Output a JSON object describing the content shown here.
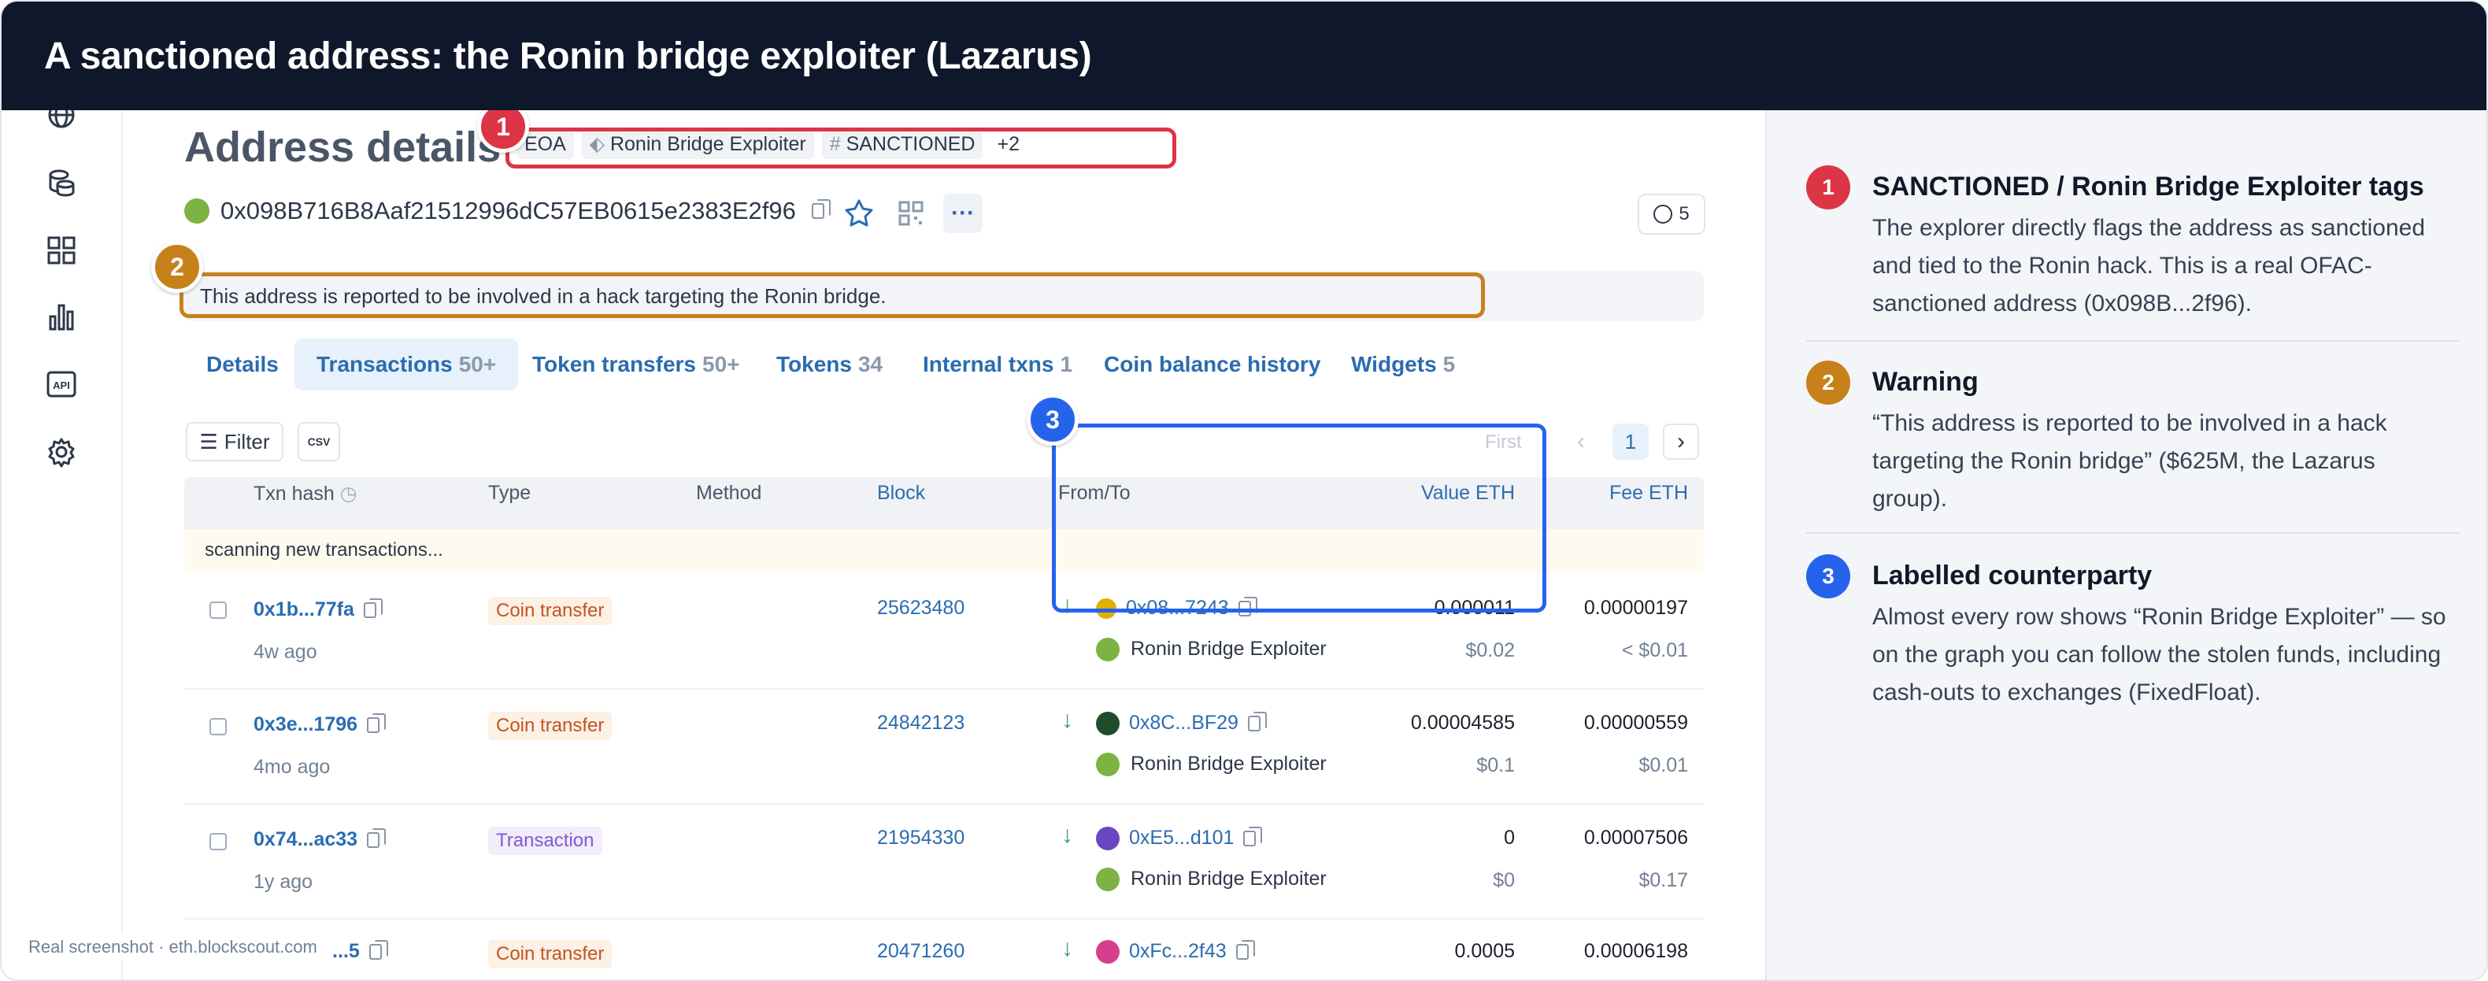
{
  "title": "A sanctioned address: the Ronin bridge exploiter (Lazarus)",
  "colors": {
    "red": "#dc3545",
    "amber": "#c7811a",
    "blue": "#2563eb",
    "green": "#7cb342",
    "link": "#2b6cb0"
  },
  "sidebar": {
    "icons": [
      "globe-icon",
      "database-icon",
      "grid-icon",
      "chart-icon",
      "api-icon",
      "gear-icon"
    ],
    "api_label": "API"
  },
  "page": {
    "heading": "Address details",
    "tags": [
      "EOA",
      "Ronin Bridge Exploiter",
      "SANCTIONED",
      "+2"
    ],
    "address": "0x098B716B8Aaf21512996dC57EB0615e2383E2f96",
    "counter": "5",
    "warning": "This address is reported to be involved in a hack targeting the Ronin bridge."
  },
  "tabs": [
    {
      "label": "Details",
      "count": ""
    },
    {
      "label": "Transactions",
      "count": "50+"
    },
    {
      "label": "Token transfers",
      "count": "50+"
    },
    {
      "label": "Tokens",
      "count": "34"
    },
    {
      "label": "Internal txns",
      "count": "1"
    },
    {
      "label": "Coin balance history",
      "count": ""
    },
    {
      "label": "Widgets",
      "count": "5"
    }
  ],
  "toolbar": {
    "filter": "Filter",
    "csv": "CSV",
    "first": "First",
    "page": "1"
  },
  "table": {
    "columns": [
      "Txn hash",
      "Type",
      "Method",
      "Block",
      "From/To",
      "Value ETH",
      "Fee ETH"
    ],
    "scanning": "scanning new transactions...",
    "rows": [
      {
        "hash": "0x1b...77fa",
        "age": "4w ago",
        "type": "Coin transfer",
        "block": "25623480",
        "addr": "0x08...7243",
        "label": "Ronin Bridge Exploiter",
        "value": "0.000011",
        "value_usd": "$0.02",
        "fee": "0.00000197",
        "fee_usd": "< $0.01"
      },
      {
        "hash": "0x3e...1796",
        "age": "4mo ago",
        "type": "Coin transfer",
        "block": "24842123",
        "addr": "0x8C...BF29",
        "label": "Ronin Bridge Exploiter",
        "value": "0.00004585",
        "value_usd": "$0.1",
        "fee": "0.00000559",
        "fee_usd": "$0.01"
      },
      {
        "hash": "0x74...ac33",
        "age": "1y ago",
        "type": "Transaction",
        "block": "21954330",
        "addr": "0xE5...d101",
        "label": "Ronin Bridge Exploiter",
        "value": "0",
        "value_usd": "$0",
        "fee": "0.00007506",
        "fee_usd": "$0.17"
      },
      {
        "hash": "...5",
        "age": "",
        "type": "Coin transfer",
        "block": "20471260",
        "addr": "0xFc...2f43",
        "label": "",
        "value": "0.0005",
        "value_usd": "",
        "fee": "0.00006198",
        "fee_usd": ""
      }
    ]
  },
  "footer": "Real screenshot · eth.blockscout.com",
  "annotations": [
    {
      "num": "1",
      "title": "SANCTIONED / Ronin Bridge Exploiter tags",
      "body": "The explorer directly flags the address as sanctioned and tied to the Ronin hack. This is a real OFAC-sanctioned address (0x098B...2f96)."
    },
    {
      "num": "2",
      "title": "Warning",
      "body": "“This address is reported to be involved in a hack targeting the Ronin bridge” ($625M, the Lazarus group)."
    },
    {
      "num": "3",
      "title": "Labelled counterparty",
      "body": "Almost every row shows “Ronin Bridge Exploiter” — so on the graph you can follow the stolen funds, including cash-outs to exchanges (FixedFloat)."
    }
  ]
}
